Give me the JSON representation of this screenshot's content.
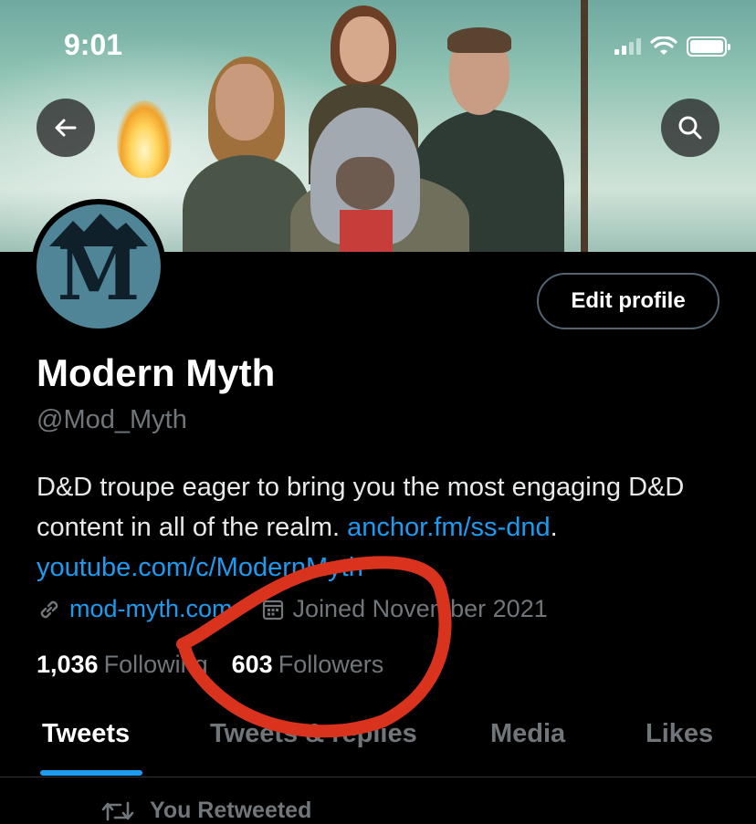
{
  "status_bar": {
    "time": "9:01"
  },
  "profile": {
    "avatar_letter": "M",
    "edit_button": "Edit profile",
    "display_name": "Modern Myth",
    "handle": "@Mod_Myth",
    "bio_text": "D&D troupe eager to bring you the most engaging D&D content in all of the realm. ",
    "bio_link1": "anchor.fm/ss-dnd",
    "bio_after_link1": ".",
    "bio_link2": "youtube.com/c/ModernMyth",
    "website": "mod-myth.com",
    "joined": "Joined November 2021",
    "following_count": "1,036",
    "following_label": "Following",
    "followers_count": "603",
    "followers_label": "Followers"
  },
  "tabs": [
    {
      "label": "Tweets",
      "active": true
    },
    {
      "label": "Tweets & replies",
      "active": false
    },
    {
      "label": "Media",
      "active": false
    },
    {
      "label": "Likes",
      "active": false
    }
  ],
  "feed": {
    "retweet_label": "You Retweeted"
  },
  "colors": {
    "accent": "#1d9bf0",
    "annotation": "#d9331d",
    "background": "#000000"
  },
  "icons": [
    "back-arrow-icon",
    "search-icon",
    "link-icon",
    "calendar-icon",
    "retweet-icon",
    "wifi-icon",
    "battery-icon",
    "signal-icon"
  ]
}
